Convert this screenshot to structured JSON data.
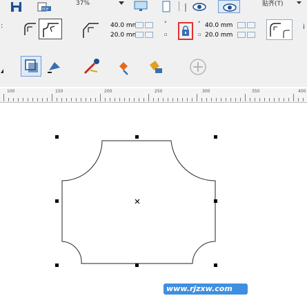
{
  "toolbar_top": {
    "zoom_value": "37%",
    "menu_label": "贴齐(T)",
    "icons": [
      "save-icon",
      "pdf-export-icon",
      "view-icon",
      "full-page-icon",
      "wireframe-view-icon",
      "enhanced-view-icon"
    ]
  },
  "property_bar": {
    "corner_radius_top_left": "40.0 mm",
    "corner_radius_bottom_left": "20.0 mm",
    "corner_radius_top_right": "40.0 mm",
    "corner_radius_bottom_right": "20.0 mm",
    "lock_label": "lock-corner-radius-icon",
    "icons": [
      "round-corner-icon",
      "scalloped-corner-icon",
      "chamfered-corner-icon",
      "relative-corner-scale-icon"
    ]
  },
  "toolbox": {
    "icons": [
      "shadow-icon",
      "transparency-icon",
      "fill-icon",
      "eyedropper-icon",
      "smart-fill-icon",
      "interactive-fill-icon",
      "add-icon"
    ]
  },
  "ruler": {
    "labels": [
      "100",
      "150",
      "200",
      "250",
      "300",
      "350",
      "400"
    ]
  },
  "watermark": {
    "text": "www.rjzxw.com"
  },
  "colors": {
    "accent_red": "#e03030",
    "selection_blue": "#6f9ad0",
    "watermark_blue": "#3e8fe0"
  }
}
